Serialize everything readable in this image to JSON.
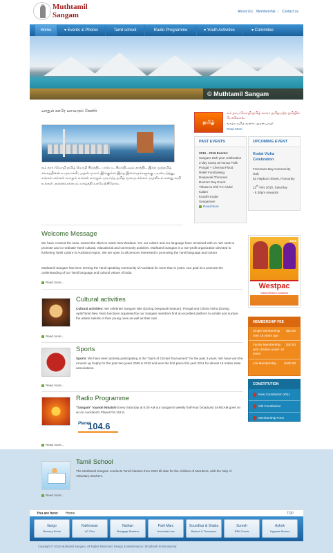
{
  "brand": {
    "line1": "Muthtamil",
    "line2": "Sangam"
  },
  "top_links": [
    "About Us",
    "Membership",
    "Contact us"
  ],
  "nav": [
    {
      "label": "Home",
      "active": true
    },
    {
      "label": "▾ Events & Photos",
      "active": false
    },
    {
      "label": "Tamil school",
      "active": false
    },
    {
      "label": "Radio Programme",
      "active": false
    },
    {
      "label": "▾ Youth Activities",
      "active": false
    },
    {
      "label": "▾ Commitee",
      "active": false
    }
  ],
  "banner": {
    "caption": "© Muthtamil Sangam"
  },
  "intro": {
    "title": "யாதும் ஊரே யாவரும் கேளிர்",
    "text": "நம் தாய் மொழி தமிழ் மொழி சிறந்திட பாடுபட சிறந்திடவும் காத்திட இந்த முத்தமிழ் சங்கத்தினை உருவாக்கி, அதன் மூலம் இங்குள்ள இந்த இளைஞர்களுக்கு பயன்படுத்து, எங்கள் எங்கள் வாழும் எங்கள் வாழும் முயர்ந்த தமிழ் மூலமு சங்கம் முதலிடம் எனது கூறி உங்கள் அனைவரையும் வாழ்த்தி வரவேற்கிறோம்."
  },
  "welcome": {
    "title": "Welcome Message",
    "p1": "We have crossed the seas, soared the skies to reach New Zealand. Yet, our culture and our language have remained with us. We seek to promote and co-ordinate Tamil cultural, educational and community activities. Muthtamil Sangam is a non-profit organization devoted to furthering Tamil culture in Auckland region. We are open to all persons interested in promoting the Tamil language and culture.",
    "p2": "Muthtamil Sangam has been serving the Tamil speaking community of Auckland for more than 6 years. Our goal is to promote the understanding of our Tamil language and cultural values of India.",
    "more": "Read more..."
  },
  "sections": [
    {
      "title": "Cultural activities",
      "bold": "Cultural activities:",
      "text": " We celebrate Sangam Nite (During Deepavali Season), Pongal and Chitrai Vizha (During April/Tamil New Year) functions organised by our Sangam members find an excellent platform to exhibit and nurture the artistic talents of their young ones as well as their own",
      "more": "Read more..."
    },
    {
      "title": "Sports",
      "bold": "Sports",
      "text": ": We have been actively participating in the \"Spirit of Cricket Tournament\" for the past 3 years. We have won the runners up trophy for the past two years 2009 & 2010 and won the first place this year 2011 for almost 16 Indian state associations.",
      "more": "Read more..."
    },
    {
      "title": "Radio Programme",
      "bold": "\"Sangam\" Vaanoli Nikalchi",
      "text": " Every Saturday at 8.00 AM our sangam's weekly half-hour broadcast SANGAM goes on air on Auckland's Planet FM 104.6.",
      "more": "Read more..."
    },
    {
      "title": "Tamil School",
      "bold": "",
      "text": "The Muthtamil Sangam conducts Tamil Classes from 2002 till date for the children of Members, with the help of Voluntary teachers.",
      "more": "Read more..."
    }
  ],
  "radio_logo": {
    "top": "Planet",
    "freq": "104.6"
  },
  "tamil_promo": {
    "badge": "தமிழ்",
    "text": "நம் தாய் மொழி தமிழ் வாரா தமிழ்பற்ற தமிழில் பேசுவோம்.",
    "sub": "வாழ்க தமிழ் வளர்க அதன் புகழ்!",
    "more": "Read More"
  },
  "past_events": {
    "head": "PAST EVENTS",
    "title": "2015 - 2016 Events:",
    "items": [
      "Sangam 15th year celebration",
      "2-day Camp at Hunua Falls",
      "Pongal + Chennai Flood Relief Fundraising",
      "Deepavali Thirunaal",
      "Doctors Day Event",
      "Tribute to Ehil P.J.Abdul Kalam",
      "Kurathi Kodai",
      "Sangamam"
    ],
    "more": "Read More"
  },
  "upcoming_event": {
    "head": "UPCOMING EVENT",
    "title": "Kodai Vizha Celebration",
    "venue": "Freemans Bay Community Hall,",
    "address": "52 Hepburn Street, Ponsonby",
    "day": "12",
    "sup": "th",
    "date_rest": " Nov 2016, Saturday",
    "time": "- 5.30pm onwards"
  },
  "poster": {
    "sponsor": "Westpac",
    "sub": "Viaduct Branch, Auckland",
    "badge": "2016"
  },
  "membership_fee": {
    "head": "MEMBERSHIP FEE",
    "rows": [
      {
        "label": "Single Membership over 18 years age",
        "price": "$20.00"
      },
      {
        "label": "Family Membership with children under 18 years",
        "price": "$30.00"
      },
      {
        "label": "Life Membership",
        "price": "$400.00"
      }
    ]
  },
  "constitution": {
    "head": "CONSTITUTION",
    "rows": [
      "New Constitution 2011",
      "Old Constitution",
      "Membership Form"
    ]
  },
  "breadcrumb": {
    "label": "You are here:",
    "current": "Home",
    "top": "TOP"
  },
  "sponsors": [
    {
      "name": "Ilango",
      "company": "Mercury Printz"
    },
    {
      "name": "Kathiravan",
      "company": "AC Plus"
    },
    {
      "name": "Nathan",
      "company": "Mortgage Masters"
    },
    {
      "name": "Parti Marc",
      "company": "Avondale Law"
    },
    {
      "name": "Soundhar & Shaba",
      "company": "Barfoot & Thompson"
    },
    {
      "name": "Suresh",
      "company": "RRK Foods"
    },
    {
      "name": "Ashok",
      "company": "Hygrade Motors"
    }
  ],
  "copyright": "Copyright © 2016 Muthtamil Sangam. All Rights Reserved. Design & Maintenance: Shudheeb Krishnakumar.",
  "colors": {
    "nav": "#1f6bb0",
    "title_green": "#2c5e22",
    "fee": "#f08a1c",
    "constitution": "#1b86b9"
  }
}
